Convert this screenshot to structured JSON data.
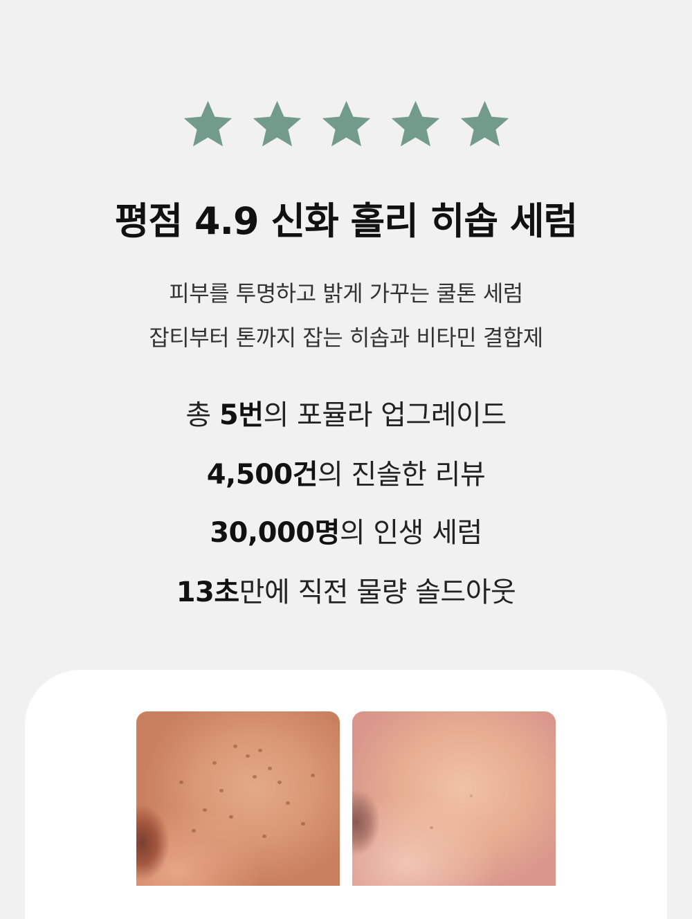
{
  "rating": {
    "stars": 5,
    "star_color": "#739b8a"
  },
  "title": "평점 4.9 신화 홀리 히솝 세럼",
  "subtitle": {
    "line1": "피부를 투명하고 밝게 가꾸는 쿨톤 세럼",
    "line2": "잡티부터 톤까지 잡는 히솝과 비타민 결합제"
  },
  "stats": [
    {
      "prefix": "총 ",
      "highlight": "5번",
      "suffix": "의 포뮬라 업그레이드"
    },
    {
      "prefix": "",
      "highlight": "4,500건",
      "suffix": "의 진솔한 리뷰"
    },
    {
      "prefix": "",
      "highlight": "30,000명",
      "suffix": "의 인생 세럼"
    },
    {
      "prefix": "",
      "highlight": "13초",
      "suffix": "만에 직전 물량 솔드아웃"
    }
  ],
  "comparison": {
    "images": [
      "before-skin-photo",
      "after-skin-photo"
    ]
  }
}
